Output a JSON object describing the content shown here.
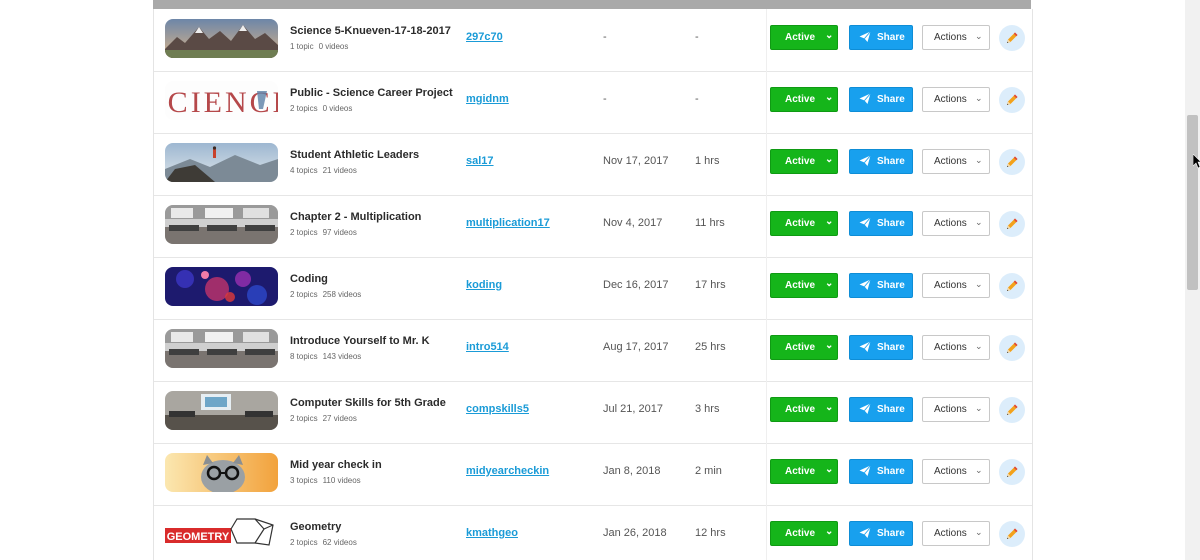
{
  "rows": [
    {
      "title": "Science 5-Knueven-17-18-2017",
      "topics": "1 topic",
      "videos": "0 videos",
      "code": "297c70",
      "date": "-",
      "duration": "-",
      "thumb": "mountains",
      "status_label": "Active",
      "share_label": "Share",
      "actions_label": "Actions"
    },
    {
      "title": "Public - Science Career Project",
      "topics": "2 topics",
      "videos": "0 videos",
      "code": "mgidnm",
      "date": "-",
      "duration": "-",
      "thumb": "science-word",
      "status_label": "Active",
      "share_label": "Share",
      "actions_label": "Actions"
    },
    {
      "title": "Student Athletic Leaders",
      "topics": "4 topics",
      "videos": "21 videos",
      "code": "sal17",
      "date": "Nov 17, 2017",
      "duration": "1 hrs",
      "thumb": "hiker",
      "status_label": "Active",
      "share_label": "Share",
      "actions_label": "Actions"
    },
    {
      "title": "Chapter 2 - Multiplication",
      "topics": "2 topics",
      "videos": "97 videos",
      "code": "multiplication17",
      "date": "Nov 4, 2017",
      "duration": "11 hrs",
      "thumb": "classroom",
      "status_label": "Active",
      "share_label": "Share",
      "actions_label": "Actions"
    },
    {
      "title": "Coding",
      "topics": "2 topics",
      "videos": "258 videos",
      "code": "koding",
      "date": "Dec 16, 2017",
      "duration": "17 hrs",
      "thumb": "bokeh",
      "status_label": "Active",
      "share_label": "Share",
      "actions_label": "Actions"
    },
    {
      "title": "Introduce Yourself to Mr. K",
      "topics": "8 topics",
      "videos": "143 videos",
      "code": "intro514",
      "date": "Aug 17, 2017",
      "duration": "25 hrs",
      "thumb": "classroom",
      "status_label": "Active",
      "share_label": "Share",
      "actions_label": "Actions"
    },
    {
      "title": "Computer Skills for 5th Grade",
      "topics": "2 topics",
      "videos": "27 videos",
      "code": "compskills5",
      "date": "Jul 21, 2017",
      "duration": "3 hrs",
      "thumb": "classroom-screen",
      "status_label": "Active",
      "share_label": "Share",
      "actions_label": "Actions"
    },
    {
      "title": "Mid year check in",
      "topics": "3 topics",
      "videos": "110 videos",
      "code": "midyearcheckin",
      "date": "Jan 8, 2018",
      "duration": "2 min",
      "thumb": "cat-glasses",
      "status_label": "Active",
      "share_label": "Share",
      "actions_label": "Actions"
    },
    {
      "title": "Geometry",
      "topics": "2 topics",
      "videos": "62 videos",
      "code": "kmathgeo",
      "date": "Jan 26, 2018",
      "duration": "12 hrs",
      "thumb": "geometry",
      "thumb_text": "GEOMETRY",
      "status_label": "Active",
      "share_label": "Share",
      "actions_label": "Actions"
    }
  ],
  "icons": {
    "status_caret": "chevron-down-icon",
    "share": "paper-plane-icon",
    "actions_caret": "chevron-down-icon",
    "edit": "pencil-icon"
  },
  "colors": {
    "active": "#15b51a",
    "share": "#18a0ee",
    "link": "#1a9bd7",
    "edit_bg": "#dcedfb"
  }
}
